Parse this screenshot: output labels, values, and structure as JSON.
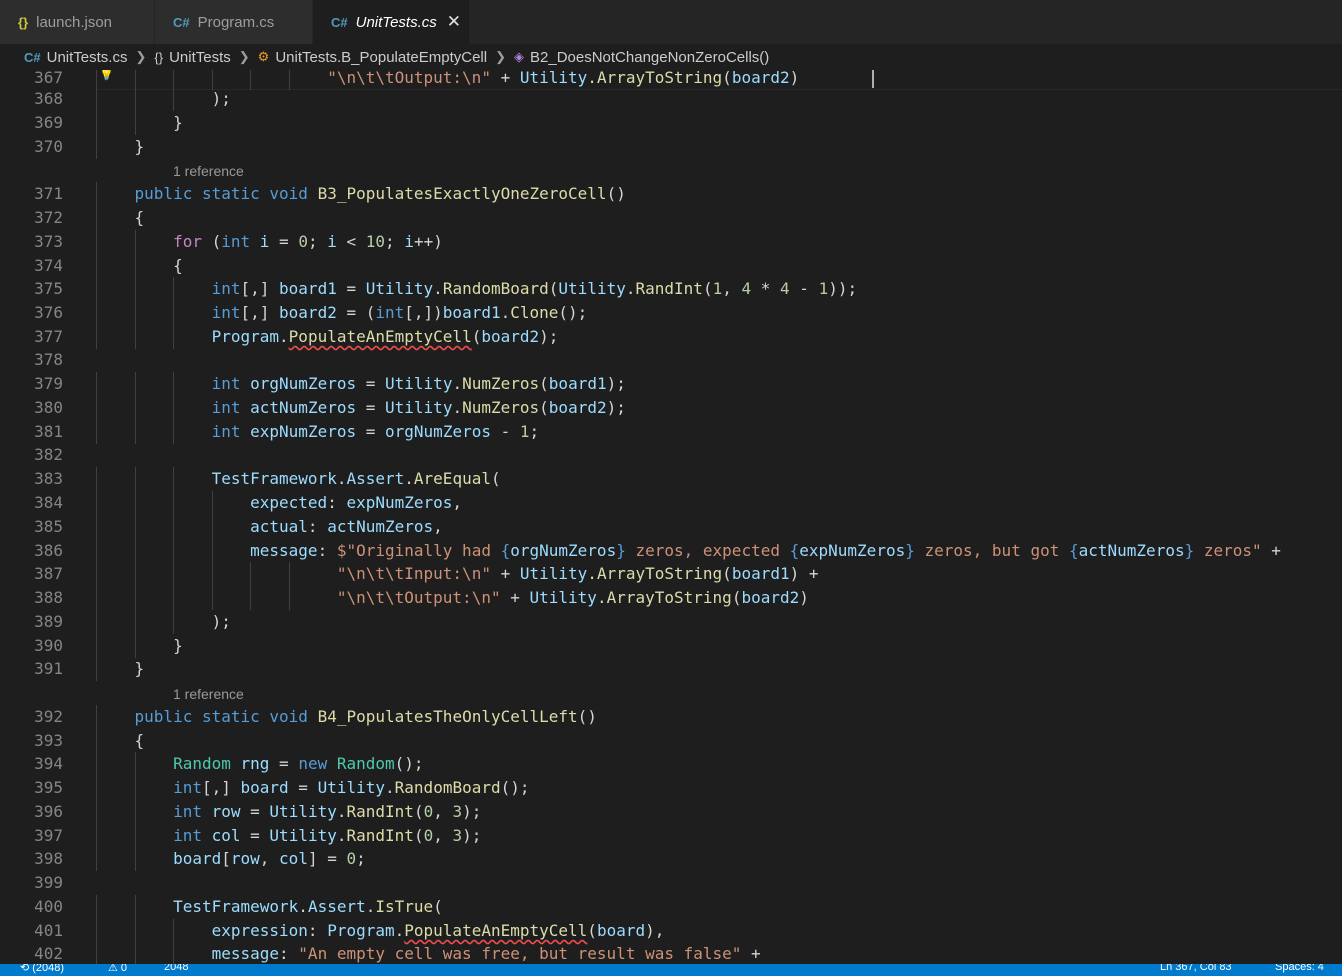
{
  "tabs": [
    {
      "label": "launch.json",
      "icon": "json-braces-icon",
      "active": false
    },
    {
      "label": "Program.cs",
      "icon": "csharp-icon",
      "active": false
    },
    {
      "label": "UnitTests.cs",
      "icon": "csharp-icon",
      "active": true
    }
  ],
  "breadcrumb": {
    "file": "UnitTests.cs",
    "namespace": "UnitTests",
    "class": "UnitTests.B_PopulateEmptyCell",
    "method": "B2_DoesNotChangeNonZeroCells()"
  },
  "codelens": {
    "ref1": "1 reference",
    "ref2": "1 reference"
  },
  "lines": [
    {
      "n": "367",
      "indent": "                        ",
      "tokens": [
        {
          "t": "\"\\n\\t\\tOutput:\\n\"",
          "c": "str"
        },
        {
          "t": " + "
        },
        {
          "t": "Utility",
          "c": "var"
        },
        {
          "t": "."
        },
        {
          "t": "ArrayToString",
          "c": "fn"
        },
        {
          "t": "("
        },
        {
          "t": "board2",
          "c": "var"
        },
        {
          "t": ")"
        }
      ]
    },
    {
      "n": "368",
      "indent": "            ",
      "tokens": [
        {
          "t": ");"
        }
      ]
    },
    {
      "n": "369",
      "indent": "        ",
      "tokens": [
        {
          "t": "}"
        }
      ]
    },
    {
      "n": "370",
      "indent": "    ",
      "tokens": [
        {
          "t": "}"
        }
      ]
    },
    {
      "n": "371",
      "indent": "    ",
      "tokens": [
        {
          "t": "public",
          "c": "kw"
        },
        {
          "t": " "
        },
        {
          "t": "static",
          "c": "kw"
        },
        {
          "t": " "
        },
        {
          "t": "void",
          "c": "kw"
        },
        {
          "t": " "
        },
        {
          "t": "B3_PopulatesExactlyOneZeroCell",
          "c": "fn"
        },
        {
          "t": "()"
        }
      ]
    },
    {
      "n": "372",
      "indent": "    ",
      "tokens": [
        {
          "t": "{"
        }
      ]
    },
    {
      "n": "373",
      "indent": "        ",
      "tokens": [
        {
          "t": "for",
          "c": "ctl"
        },
        {
          "t": " ("
        },
        {
          "t": "int",
          "c": "kw"
        },
        {
          "t": " "
        },
        {
          "t": "i",
          "c": "var"
        },
        {
          "t": " = "
        },
        {
          "t": "0",
          "c": "num"
        },
        {
          "t": "; "
        },
        {
          "t": "i",
          "c": "var"
        },
        {
          "t": " < "
        },
        {
          "t": "10",
          "c": "num"
        },
        {
          "t": "; "
        },
        {
          "t": "i",
          "c": "var"
        },
        {
          "t": "++)"
        }
      ]
    },
    {
      "n": "374",
      "indent": "        ",
      "tokens": [
        {
          "t": "{"
        }
      ]
    },
    {
      "n": "375",
      "indent": "            ",
      "tokens": [
        {
          "t": "int",
          "c": "kw"
        },
        {
          "t": "[,] "
        },
        {
          "t": "board1",
          "c": "var"
        },
        {
          "t": " = "
        },
        {
          "t": "Utility",
          "c": "var"
        },
        {
          "t": "."
        },
        {
          "t": "RandomBoard",
          "c": "fn"
        },
        {
          "t": "("
        },
        {
          "t": "Utility",
          "c": "var"
        },
        {
          "t": "."
        },
        {
          "t": "RandInt",
          "c": "fn"
        },
        {
          "t": "("
        },
        {
          "t": "1",
          "c": "num"
        },
        {
          "t": ", "
        },
        {
          "t": "4",
          "c": "num"
        },
        {
          "t": " * "
        },
        {
          "t": "4",
          "c": "num"
        },
        {
          "t": " - "
        },
        {
          "t": "1",
          "c": "num"
        },
        {
          "t": "));"
        }
      ]
    },
    {
      "n": "376",
      "indent": "            ",
      "tokens": [
        {
          "t": "int",
          "c": "kw"
        },
        {
          "t": "[,] "
        },
        {
          "t": "board2",
          "c": "var"
        },
        {
          "t": " = ("
        },
        {
          "t": "int",
          "c": "kw"
        },
        {
          "t": "[,])"
        },
        {
          "t": "board1",
          "c": "var"
        },
        {
          "t": "."
        },
        {
          "t": "Clone",
          "c": "fn"
        },
        {
          "t": "();"
        }
      ]
    },
    {
      "n": "377",
      "indent": "            ",
      "tokens": [
        {
          "t": "Program",
          "c": "var"
        },
        {
          "t": "."
        },
        {
          "t": "PopulateAnEmptyCell",
          "c": "fn err"
        },
        {
          "t": "("
        },
        {
          "t": "board2",
          "c": "var"
        },
        {
          "t": ");"
        }
      ]
    },
    {
      "n": "378",
      "indent": "",
      "tokens": []
    },
    {
      "n": "379",
      "indent": "            ",
      "tokens": [
        {
          "t": "int",
          "c": "kw"
        },
        {
          "t": " "
        },
        {
          "t": "orgNumZeros",
          "c": "var"
        },
        {
          "t": " = "
        },
        {
          "t": "Utility",
          "c": "var"
        },
        {
          "t": "."
        },
        {
          "t": "NumZeros",
          "c": "fn"
        },
        {
          "t": "("
        },
        {
          "t": "board1",
          "c": "var"
        },
        {
          "t": ");"
        }
      ]
    },
    {
      "n": "380",
      "indent": "            ",
      "tokens": [
        {
          "t": "int",
          "c": "kw"
        },
        {
          "t": " "
        },
        {
          "t": "actNumZeros",
          "c": "var"
        },
        {
          "t": " = "
        },
        {
          "t": "Utility",
          "c": "var"
        },
        {
          "t": "."
        },
        {
          "t": "NumZeros",
          "c": "fn"
        },
        {
          "t": "("
        },
        {
          "t": "board2",
          "c": "var"
        },
        {
          "t": ");"
        }
      ]
    },
    {
      "n": "381",
      "indent": "            ",
      "tokens": [
        {
          "t": "int",
          "c": "kw"
        },
        {
          "t": " "
        },
        {
          "t": "expNumZeros",
          "c": "var"
        },
        {
          "t": " = "
        },
        {
          "t": "orgNumZeros",
          "c": "var"
        },
        {
          "t": " - "
        },
        {
          "t": "1",
          "c": "num"
        },
        {
          "t": ";"
        }
      ]
    },
    {
      "n": "382",
      "indent": "",
      "tokens": []
    },
    {
      "n": "383",
      "indent": "            ",
      "tokens": [
        {
          "t": "TestFramework",
          "c": "var"
        },
        {
          "t": "."
        },
        {
          "t": "Assert",
          "c": "var"
        },
        {
          "t": "."
        },
        {
          "t": "AreEqual",
          "c": "fn"
        },
        {
          "t": "("
        }
      ]
    },
    {
      "n": "384",
      "indent": "                ",
      "tokens": [
        {
          "t": "expected",
          "c": "var"
        },
        {
          "t": ": "
        },
        {
          "t": "expNumZeros",
          "c": "var"
        },
        {
          "t": ","
        }
      ]
    },
    {
      "n": "385",
      "indent": "                ",
      "tokens": [
        {
          "t": "actual",
          "c": "var"
        },
        {
          "t": ": "
        },
        {
          "t": "actNumZeros",
          "c": "var"
        },
        {
          "t": ","
        }
      ]
    },
    {
      "n": "386",
      "indent": "                ",
      "tokens": [
        {
          "t": "message",
          "c": "var"
        },
        {
          "t": ": "
        },
        {
          "t": "$\"Originally had ",
          "c": "str"
        },
        {
          "t": "{",
          "c": "kw"
        },
        {
          "t": "orgNumZeros",
          "c": "var"
        },
        {
          "t": "}",
          "c": "kw"
        },
        {
          "t": " zeros, expected ",
          "c": "str"
        },
        {
          "t": "{",
          "c": "kw"
        },
        {
          "t": "expNumZeros",
          "c": "var"
        },
        {
          "t": "}",
          "c": "kw"
        },
        {
          "t": " zeros, but got ",
          "c": "str"
        },
        {
          "t": "{",
          "c": "kw"
        },
        {
          "t": "actNumZeros",
          "c": "var"
        },
        {
          "t": "}",
          "c": "kw"
        },
        {
          "t": " zeros\"",
          "c": "str"
        },
        {
          "t": " +"
        }
      ]
    },
    {
      "n": "387",
      "indent": "                         ",
      "tokens": [
        {
          "t": "\"\\n\\t\\tInput:\\n\"",
          "c": "str"
        },
        {
          "t": " + "
        },
        {
          "t": "Utility",
          "c": "var"
        },
        {
          "t": "."
        },
        {
          "t": "ArrayToString",
          "c": "fn"
        },
        {
          "t": "("
        },
        {
          "t": "board1",
          "c": "var"
        },
        {
          "t": ") +"
        }
      ]
    },
    {
      "n": "388",
      "indent": "                         ",
      "tokens": [
        {
          "t": "\"\\n\\t\\tOutput:\\n\"",
          "c": "str"
        },
        {
          "t": " + "
        },
        {
          "t": "Utility",
          "c": "var"
        },
        {
          "t": "."
        },
        {
          "t": "ArrayToString",
          "c": "fn"
        },
        {
          "t": "("
        },
        {
          "t": "board2",
          "c": "var"
        },
        {
          "t": ")"
        }
      ]
    },
    {
      "n": "389",
      "indent": "            ",
      "tokens": [
        {
          "t": ");"
        }
      ]
    },
    {
      "n": "390",
      "indent": "        ",
      "tokens": [
        {
          "t": "}"
        }
      ]
    },
    {
      "n": "391",
      "indent": "    ",
      "tokens": [
        {
          "t": "}"
        }
      ]
    },
    {
      "n": "392",
      "indent": "    ",
      "tokens": [
        {
          "t": "public",
          "c": "kw"
        },
        {
          "t": " "
        },
        {
          "t": "static",
          "c": "kw"
        },
        {
          "t": " "
        },
        {
          "t": "void",
          "c": "kw"
        },
        {
          "t": " "
        },
        {
          "t": "B4_PopulatesTheOnlyCellLeft",
          "c": "fn"
        },
        {
          "t": "()"
        }
      ]
    },
    {
      "n": "393",
      "indent": "    ",
      "tokens": [
        {
          "t": "{"
        }
      ]
    },
    {
      "n": "394",
      "indent": "        ",
      "tokens": [
        {
          "t": "Random",
          "c": "ty"
        },
        {
          "t": " "
        },
        {
          "t": "rng",
          "c": "var"
        },
        {
          "t": " = "
        },
        {
          "t": "new",
          "c": "kw"
        },
        {
          "t": " "
        },
        {
          "t": "Random",
          "c": "ty"
        },
        {
          "t": "();"
        }
      ]
    },
    {
      "n": "395",
      "indent": "        ",
      "tokens": [
        {
          "t": "int",
          "c": "kw"
        },
        {
          "t": "[,] "
        },
        {
          "t": "board",
          "c": "var"
        },
        {
          "t": " = "
        },
        {
          "t": "Utility",
          "c": "var"
        },
        {
          "t": "."
        },
        {
          "t": "RandomBoard",
          "c": "fn"
        },
        {
          "t": "();"
        }
      ]
    },
    {
      "n": "396",
      "indent": "        ",
      "tokens": [
        {
          "t": "int",
          "c": "kw"
        },
        {
          "t": " "
        },
        {
          "t": "row",
          "c": "var"
        },
        {
          "t": " = "
        },
        {
          "t": "Utility",
          "c": "var"
        },
        {
          "t": "."
        },
        {
          "t": "RandInt",
          "c": "fn"
        },
        {
          "t": "("
        },
        {
          "t": "0",
          "c": "num"
        },
        {
          "t": ", "
        },
        {
          "t": "3",
          "c": "num"
        },
        {
          "t": ");"
        }
      ]
    },
    {
      "n": "397",
      "indent": "        ",
      "tokens": [
        {
          "t": "int",
          "c": "kw"
        },
        {
          "t": " "
        },
        {
          "t": "col",
          "c": "var"
        },
        {
          "t": " = "
        },
        {
          "t": "Utility",
          "c": "var"
        },
        {
          "t": "."
        },
        {
          "t": "RandInt",
          "c": "fn"
        },
        {
          "t": "("
        },
        {
          "t": "0",
          "c": "num"
        },
        {
          "t": ", "
        },
        {
          "t": "3",
          "c": "num"
        },
        {
          "t": ");"
        }
      ]
    },
    {
      "n": "398",
      "indent": "        ",
      "tokens": [
        {
          "t": "board",
          "c": "var"
        },
        {
          "t": "["
        },
        {
          "t": "row",
          "c": "var"
        },
        {
          "t": ", "
        },
        {
          "t": "col",
          "c": "var"
        },
        {
          "t": "] = "
        },
        {
          "t": "0",
          "c": "num"
        },
        {
          "t": ";"
        }
      ]
    },
    {
      "n": "399",
      "indent": "",
      "tokens": []
    },
    {
      "n": "400",
      "indent": "        ",
      "tokens": [
        {
          "t": "TestFramework",
          "c": "var"
        },
        {
          "t": "."
        },
        {
          "t": "Assert",
          "c": "var"
        },
        {
          "t": "."
        },
        {
          "t": "IsTrue",
          "c": "fn"
        },
        {
          "t": "("
        }
      ]
    },
    {
      "n": "401",
      "indent": "            ",
      "tokens": [
        {
          "t": "expression",
          "c": "var"
        },
        {
          "t": ": "
        },
        {
          "t": "Program",
          "c": "var"
        },
        {
          "t": "."
        },
        {
          "t": "PopulateAnEmptyCell",
          "c": "fn err"
        },
        {
          "t": "("
        },
        {
          "t": "board",
          "c": "var"
        },
        {
          "t": "),"
        }
      ]
    },
    {
      "n": "402",
      "indent": "            ",
      "tokens": [
        {
          "t": "message",
          "c": "var"
        },
        {
          "t": ": "
        },
        {
          "t": "\"An empty cell was free, but result was false\"",
          "c": "str"
        },
        {
          "t": " +"
        }
      ]
    }
  ],
  "statusbar": {
    "left": "⟲ (2048)",
    "warnings": "⚠ 0",
    "branch": "2048",
    "position": "Ln 367, Col 83",
    "spaces": "Spaces: 4"
  }
}
